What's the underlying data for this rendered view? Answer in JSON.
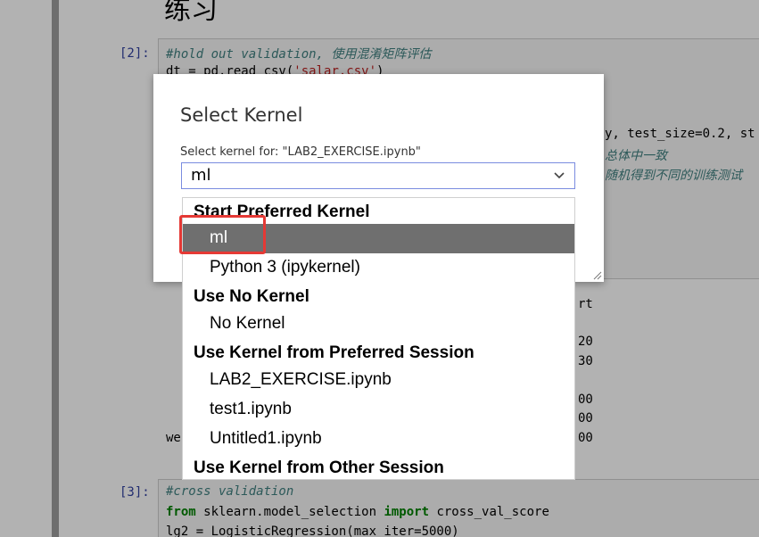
{
  "notebook": {
    "heading": "练习",
    "cell1": {
      "prompt": "[2]:",
      "line1": "#hold out validation, 使用混淆矩阵评估",
      "line2_prefix": "dt = pd.read_csv(",
      "line2_str": "'salar.csv'",
      "line2_suffix": ")",
      "line3": "y, test_size=0.2, st",
      "line4": "总体中一致",
      "line5": "随机得到不同的训练测试"
    },
    "output": {
      "header": "rt",
      "r1": "20",
      "r2": "30",
      "r3": "00",
      "r4": "00",
      "r5": "00",
      "weighted_prefix": "we"
    },
    "cell2": {
      "prompt": "[3]:",
      "line1": "#cross validation",
      "line2_kw1": "from",
      "line2_mid": " sklearn.model_selection ",
      "line2_kw2": "import",
      "line2_end": " cross_val_score",
      "line3": "lg2 = LogisticRegression(max_iter=5000)"
    }
  },
  "dialog": {
    "title": "Select Kernel",
    "subtitle": "Select kernel for: \"LAB2_EXERCISE.ipynb\"",
    "selected_value": "ml",
    "chevron_icon": "chevron-down-icon"
  },
  "dropdown": {
    "groups": [
      {
        "label": "Start Preferred Kernel",
        "options": [
          {
            "label": "ml",
            "selected": true
          },
          {
            "label": "Python 3 (ipykernel)",
            "selected": false
          }
        ]
      },
      {
        "label": "Use No Kernel",
        "options": [
          {
            "label": "No Kernel",
            "selected": false
          }
        ]
      },
      {
        "label": "Use Kernel from Preferred Session",
        "options": [
          {
            "label": "LAB2_EXERCISE.ipynb",
            "selected": false
          },
          {
            "label": "test1.ipynb",
            "selected": false
          },
          {
            "label": "Untitled1.ipynb",
            "selected": false
          }
        ]
      },
      {
        "label": "Use Kernel from Other Session",
        "options": []
      }
    ]
  },
  "colors": {
    "overlay": "rgba(0,0,0,0.30)",
    "selected_bg": "#6f6f6f",
    "highlight_border": "#e53935",
    "select_border": "#7a8ce0"
  }
}
